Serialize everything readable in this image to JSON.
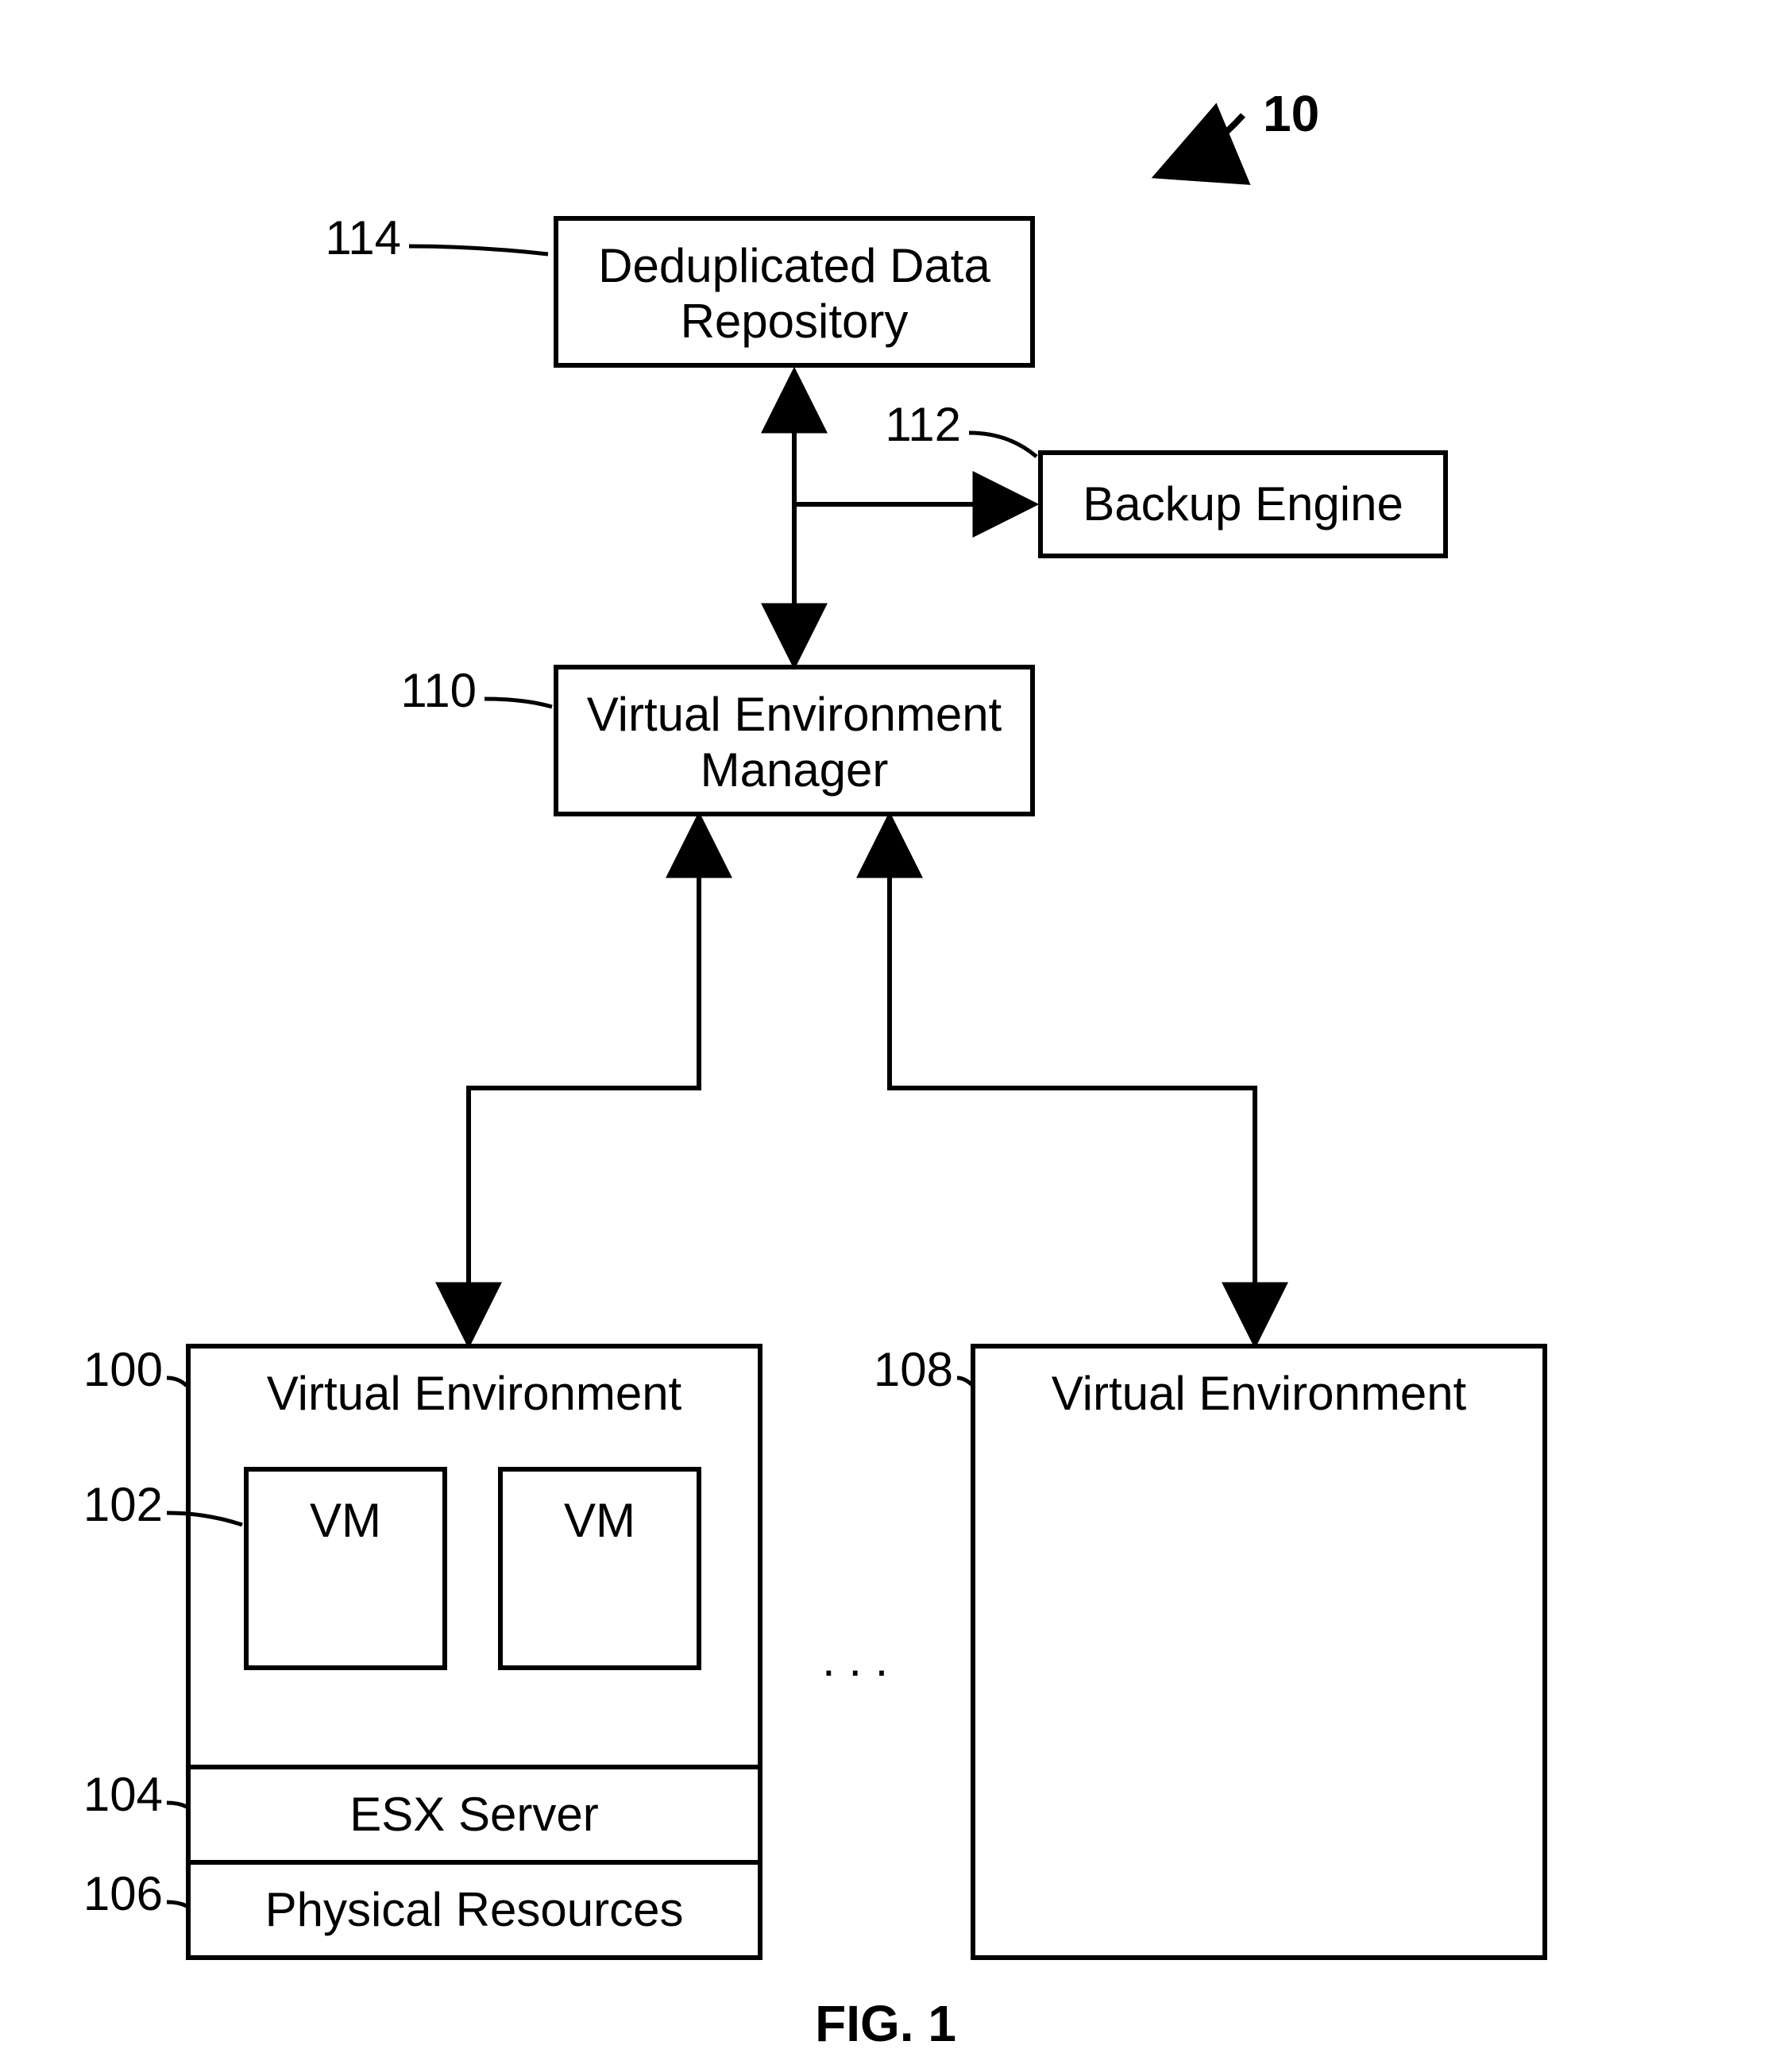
{
  "figure_ref": "10",
  "figure_label": "FIG. 1",
  "boxes": {
    "dedup_repo": {
      "ref": "114",
      "line1": "Deduplicated Data",
      "line2": "Repository"
    },
    "backup_engine": {
      "ref": "112",
      "label": "Backup Engine"
    },
    "venv_manager": {
      "ref": "110",
      "line1": "Virtual Environment",
      "line2": "Manager"
    },
    "venv_left": {
      "ref": "100",
      "title": "Virtual Environment",
      "vm_ref": "102",
      "vm1": "VM",
      "vm2": "VM",
      "esx_ref": "104",
      "esx_label": "ESX Server",
      "phys_ref": "106",
      "phys_label": "Physical Resources"
    },
    "venv_right": {
      "ref": "108",
      "title": "Virtual Environment"
    }
  },
  "ellipsis": ". . ."
}
